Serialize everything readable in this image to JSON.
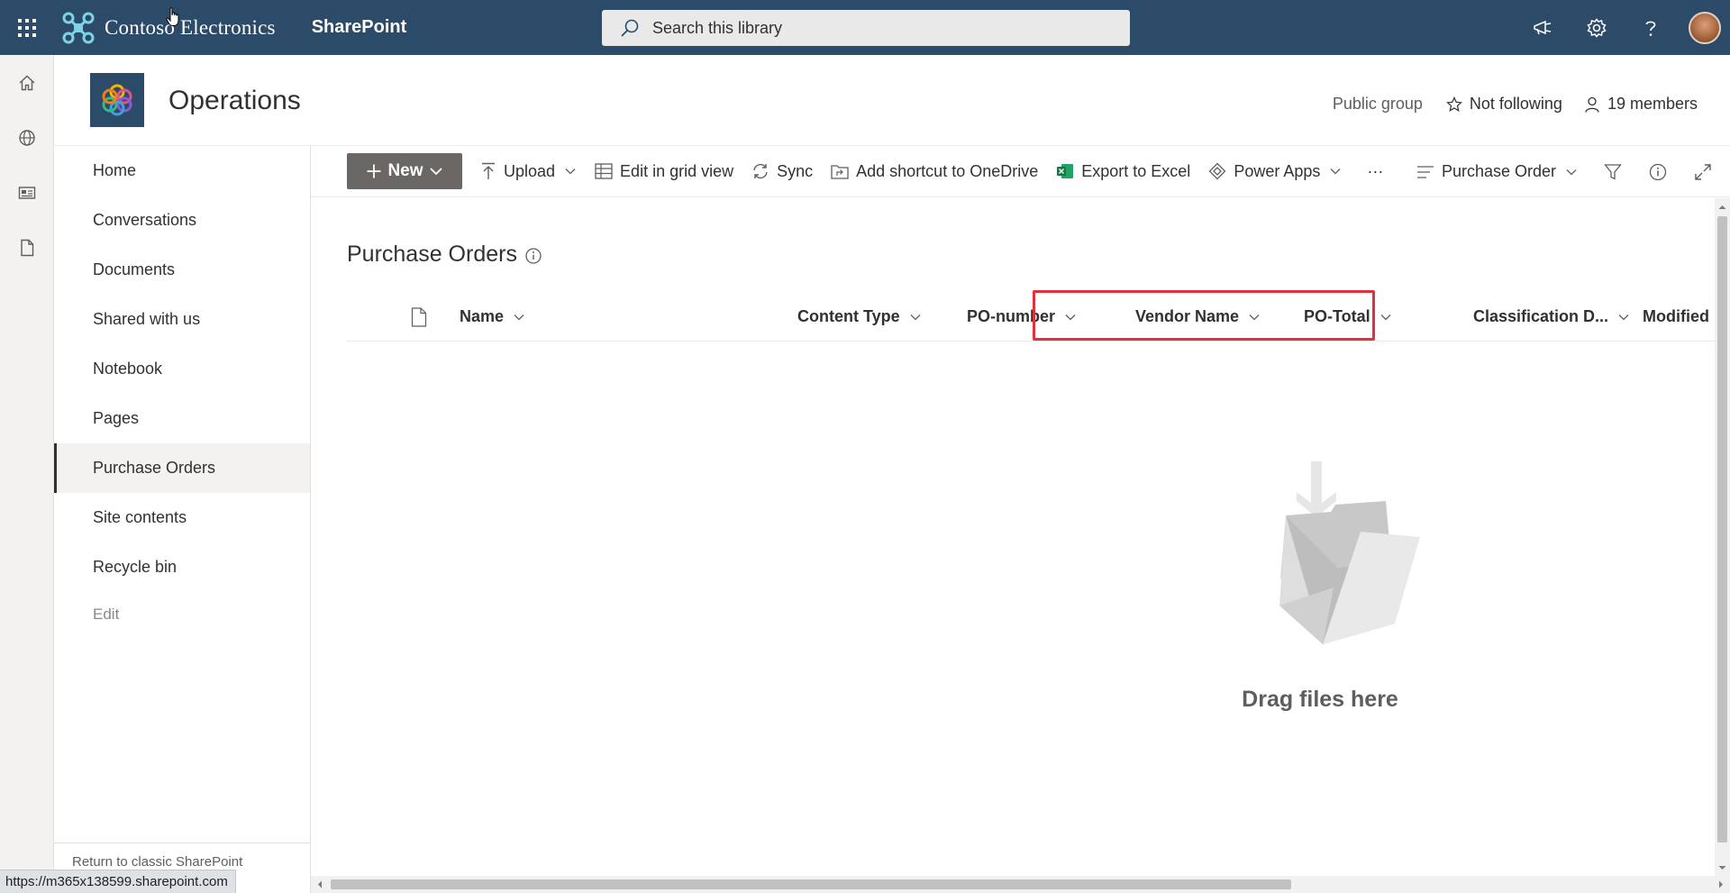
{
  "suite": {
    "brand": "Contoso Electronics",
    "app": "SharePoint",
    "search_placeholder": "Search this library"
  },
  "site": {
    "title": "Operations",
    "group_type": "Public group",
    "follow_label": "Not following",
    "members_label": "19 members"
  },
  "nav": {
    "items": [
      {
        "label": "Home"
      },
      {
        "label": "Conversations"
      },
      {
        "label": "Documents"
      },
      {
        "label": "Shared with us"
      },
      {
        "label": "Notebook"
      },
      {
        "label": "Pages"
      },
      {
        "label": "Purchase Orders"
      },
      {
        "label": "Site contents"
      },
      {
        "label": "Recycle bin"
      }
    ],
    "edit_label": "Edit",
    "footer": "Return to classic SharePoint"
  },
  "commands": {
    "new": "New",
    "upload": "Upload",
    "grid": "Edit in grid view",
    "sync": "Sync",
    "shortcut": "Add shortcut to OneDrive",
    "export": "Export to Excel",
    "powerapps": "Power Apps",
    "more": "···",
    "view": "Purchase Order"
  },
  "library": {
    "title": "Purchase Orders",
    "columns": {
      "name": "Name",
      "content_type": "Content Type",
      "po_number": "PO-number",
      "vendor": "Vendor Name",
      "po_total": "PO-Total",
      "classification": "Classification D...",
      "modified": "Modified"
    },
    "empty_message": "Drag files here"
  },
  "status_url": "https://m365x138599.sharepoint.com",
  "colors": {
    "suitebar": "#2b4b68",
    "highlight": "#e0323c",
    "new_button": "#6b6765"
  },
  "active_nav": "Purchase Orders"
}
